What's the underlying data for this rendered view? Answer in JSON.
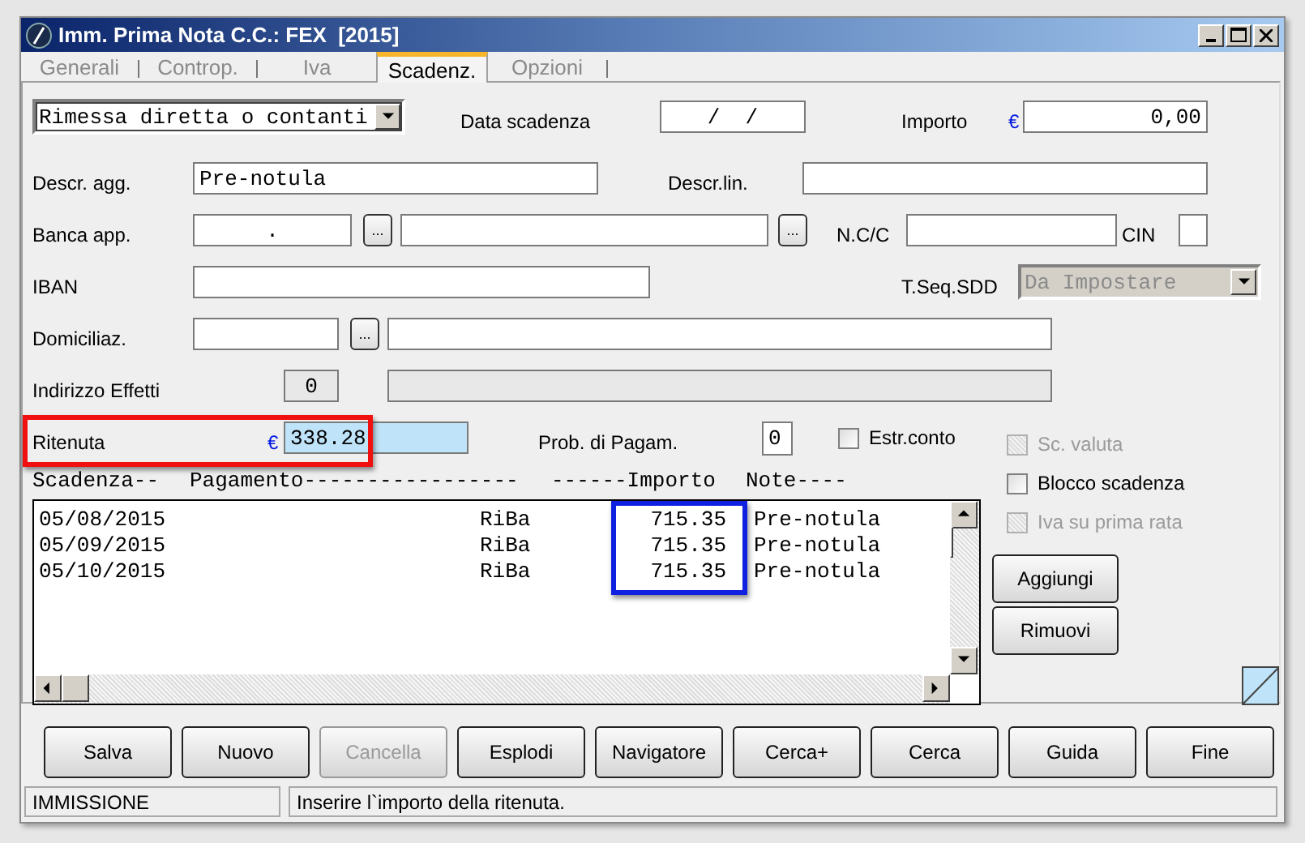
{
  "window": {
    "title": "Imm. Prima Nota C.C.: FEX  [2015]"
  },
  "tabs": [
    {
      "label": "Generali",
      "selected": false
    },
    {
      "label": "Controp.",
      "selected": false
    },
    {
      "label": "Iva",
      "selected": false
    },
    {
      "label": "Scadenz.",
      "selected": true
    },
    {
      "label": "Opzioni",
      "selected": false
    }
  ],
  "form": {
    "tipo_pagamento": {
      "value": "Rimessa diretta o contanti"
    },
    "data_scadenza": {
      "label": "Data scadenza",
      "value": "/  /"
    },
    "importo": {
      "label": "Importo",
      "currency": "€",
      "value": "0,00"
    },
    "descr_agg": {
      "label": "Descr. agg.",
      "value": "Pre-notula"
    },
    "descr_lin": {
      "label": "Descr.lin."
    },
    "banca_app": {
      "label": "Banca app.",
      "value": ".",
      "browse_buttons": [
        "...",
        "..."
      ]
    },
    "ncc": {
      "label": "N.C/C"
    },
    "cin": {
      "label": "CIN"
    },
    "iban": {
      "label": "IBAN"
    },
    "t_seq_sdd": {
      "label": "T.Seq.SDD",
      "value": "Da Impostare",
      "disabled": true
    },
    "domiciliaz": {
      "label": "Domiciliaz.",
      "browse_button": "..."
    },
    "indirizzo_effetti": {
      "label": "Indirizzo Effetti",
      "value": "0"
    },
    "ritenuta": {
      "label": "Ritenuta",
      "currency": "€",
      "value": "338.28",
      "highlighted": true
    },
    "prob_pagam": {
      "label": "Prob. di Pagam.",
      "value": "0"
    },
    "options": [
      {
        "label": "Estr.conto",
        "checked": false,
        "disabled": false
      },
      {
        "label": "Sc. valuta",
        "checked": false,
        "disabled": true
      },
      {
        "label": "Blocco scadenza",
        "checked": false,
        "disabled": false
      },
      {
        "label": "Iva su prima rata",
        "checked": false,
        "disabled": true
      }
    ]
  },
  "list": {
    "columns": [
      "Scadenza--",
      "Pagamento-----------------",
      "------Importo",
      "Note----"
    ],
    "importo_highlighted": true,
    "rows": [
      {
        "scadenza": "05/08/2015",
        "pagamento": "RiBa",
        "importo": "715.35",
        "note": "Pre-notula"
      },
      {
        "scadenza": "05/09/2015",
        "pagamento": "RiBa",
        "importo": "715.35",
        "note": "Pre-notula"
      },
      {
        "scadenza": "05/10/2015",
        "pagamento": "RiBa",
        "importo": "715.35",
        "note": "Pre-notula"
      }
    ]
  },
  "side_buttons": [
    "Aggiungi",
    "Rimuovi"
  ],
  "buttons": [
    {
      "label": "Salva",
      "disabled": false
    },
    {
      "label": "Nuovo",
      "disabled": false
    },
    {
      "label": "Cancella",
      "disabled": true
    },
    {
      "label": "Esplodi",
      "disabled": false
    },
    {
      "label": "Navigatore",
      "disabled": false
    },
    {
      "label": "Cerca+",
      "disabled": false
    },
    {
      "label": "Cerca",
      "disabled": false
    },
    {
      "label": "Guida",
      "disabled": false
    },
    {
      "label": "Fine",
      "disabled": false
    }
  ],
  "status_bar": {
    "mode": "IMMISSIONE",
    "message": "Inserire l`importo della ritenuta."
  }
}
